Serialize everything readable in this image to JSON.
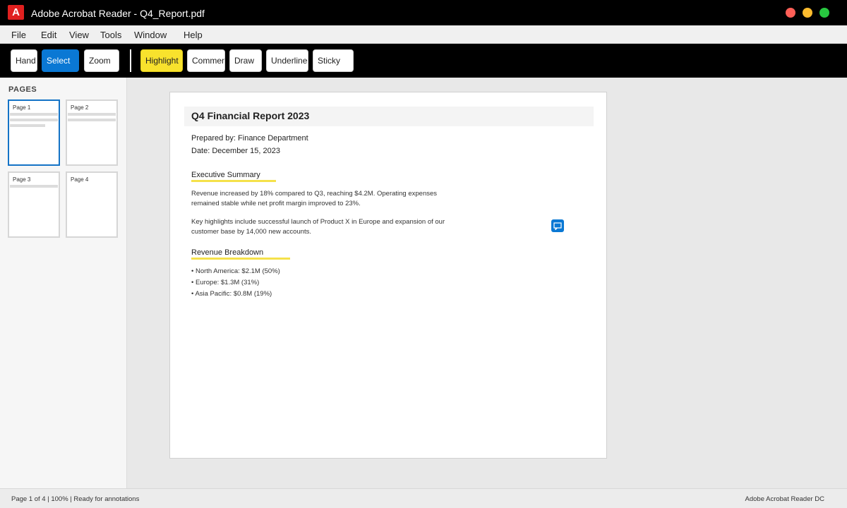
{
  "window": {
    "logo_letter": "A",
    "title": "Adobe Acrobat Reader - Q4_Report.pdf"
  },
  "menu": {
    "items": [
      "File",
      "Edit",
      "View",
      "Tools",
      "Window",
      "Help"
    ]
  },
  "toolbar": {
    "tools": [
      "Hand",
      "Select",
      "Zoom"
    ],
    "annotations": [
      "Highlight",
      "Comment",
      "Draw",
      "Underline",
      "Sticky"
    ],
    "active_tool": "Select",
    "accent_color": "#0a78d4",
    "highlight_color": "#f8e22d"
  },
  "sidebar": {
    "title": "PAGES",
    "pages": [
      "Page 1",
      "Page 2",
      "Page 3",
      "Page 4"
    ],
    "selected_page": "Page 1"
  },
  "document": {
    "title": "Q4 Financial Report 2023",
    "prepared_by": "Prepared by: Finance Department",
    "date": "Date: December 15, 2023",
    "sections": {
      "summary": {
        "heading": "Executive Summary",
        "para1": "Revenue increased by 18% compared to Q3, reaching $4.2M. Operating expenses remained stable while net profit margin improved to 23%.",
        "para2": "Key highlights include successful launch of Product X in Europe and expansion of our customer base by 14,000 new accounts."
      },
      "revenue": {
        "heading": "Revenue Breakdown",
        "bullets": [
          "• North America: $2.1M (50%)",
          "• Europe: $1.3M (31%)",
          "• Asia Pacific: $0.8M (19%)"
        ]
      }
    },
    "comment_icon": "comment-icon"
  },
  "status": {
    "left": "Page 1 of 4 | 100% | Ready for annotations",
    "right": "Adobe Acrobat Reader DC"
  }
}
